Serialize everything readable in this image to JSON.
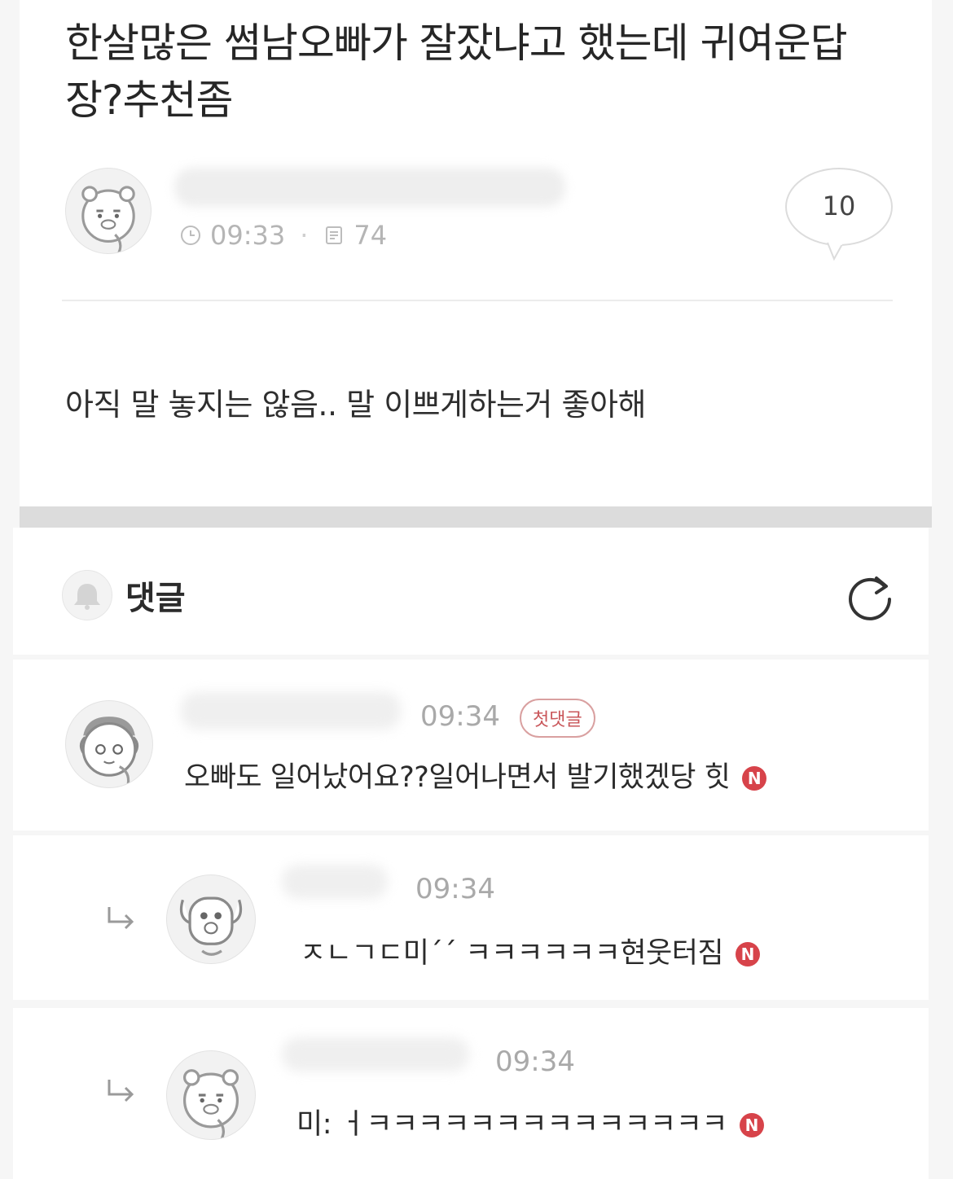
{
  "post": {
    "title": "한살많은 썸남오빠가 잘잤냐고 했는데 귀여운답장?추천좀",
    "time": "09:33",
    "views": "74",
    "comment_count": "10",
    "body": "아직 말 놓지는 않음.. 말 이쁘게하는거 좋아해"
  },
  "comments_section": {
    "title": "댓글"
  },
  "comments": [
    {
      "time": "09:34",
      "badge": "첫댓글",
      "text": "오빠도 일어났어요??일어나면서 발기했겠당 힛",
      "new_mark": "N"
    },
    {
      "time": "09:34",
      "text": "ㅈㄴㄱㄷ미´´ ㅋㅋㅋㅋㅋㅋ현웃터짐",
      "new_mark": "N"
    },
    {
      "time": "09:34",
      "text": "미: ㅓㅋㅋㅋㅋㅋㅋㅋㅋㅋㅋㅋㅋㅋㅋ",
      "new_mark": "N"
    }
  ],
  "icons": [
    "clock-icon",
    "document-icon",
    "speech-bubble-icon",
    "bell-icon",
    "refresh-icon",
    "reply-arrow-icon"
  ],
  "colors": {
    "new_badge": "#d7434a",
    "first_comment_badge": "#c9565a"
  }
}
